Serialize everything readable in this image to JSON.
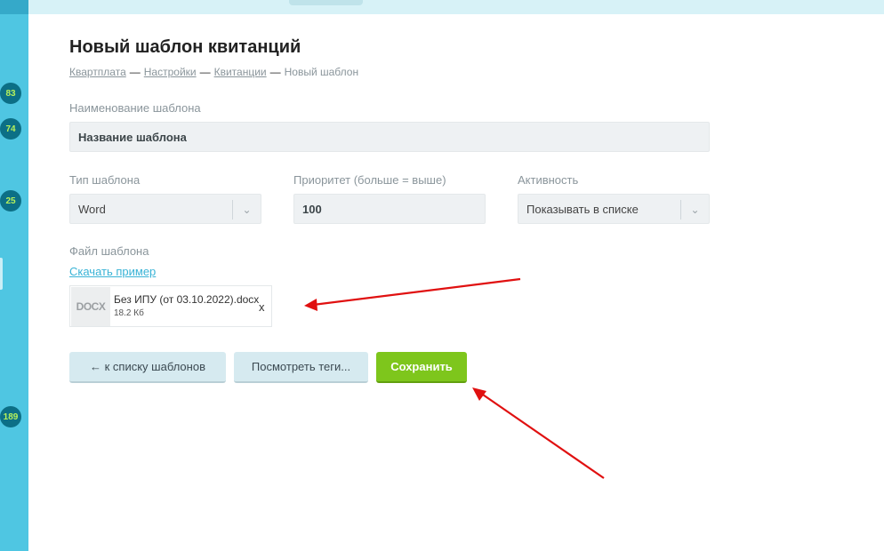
{
  "sidebar": {
    "badges": [
      "83",
      "74",
      "25",
      "189"
    ]
  },
  "page": {
    "title": "Новый шаблон квитанций"
  },
  "breadcrumb": {
    "items": [
      "Квартплата",
      "Настройки",
      "Квитанции"
    ],
    "separator": "—",
    "current": "Новый шаблон"
  },
  "form": {
    "name_label": "Наименование шаблона",
    "name_value": "Название шаблона",
    "type_label": "Тип шаблона",
    "type_value": "Word",
    "priority_label": "Приоритет (больше = выше)",
    "priority_value": "100",
    "activity_label": "Активность",
    "activity_value": "Показывать в списке",
    "file_label": "Файл шаблона",
    "download_link": "Скачать пример"
  },
  "file": {
    "type": "DOCX",
    "name": "Без ИПУ (от 03.10.2022).docx",
    "size": "18.2 Кб",
    "remove": "x"
  },
  "buttons": {
    "back": "← к списку шаблонов",
    "tags": "Посмотреть теги...",
    "save": "Сохранить"
  },
  "colors": {
    "sidebar": "#4fc6e2",
    "badge": "#0c6f86",
    "accent_green": "#7ec61c",
    "annotation_red": "#e01010"
  }
}
